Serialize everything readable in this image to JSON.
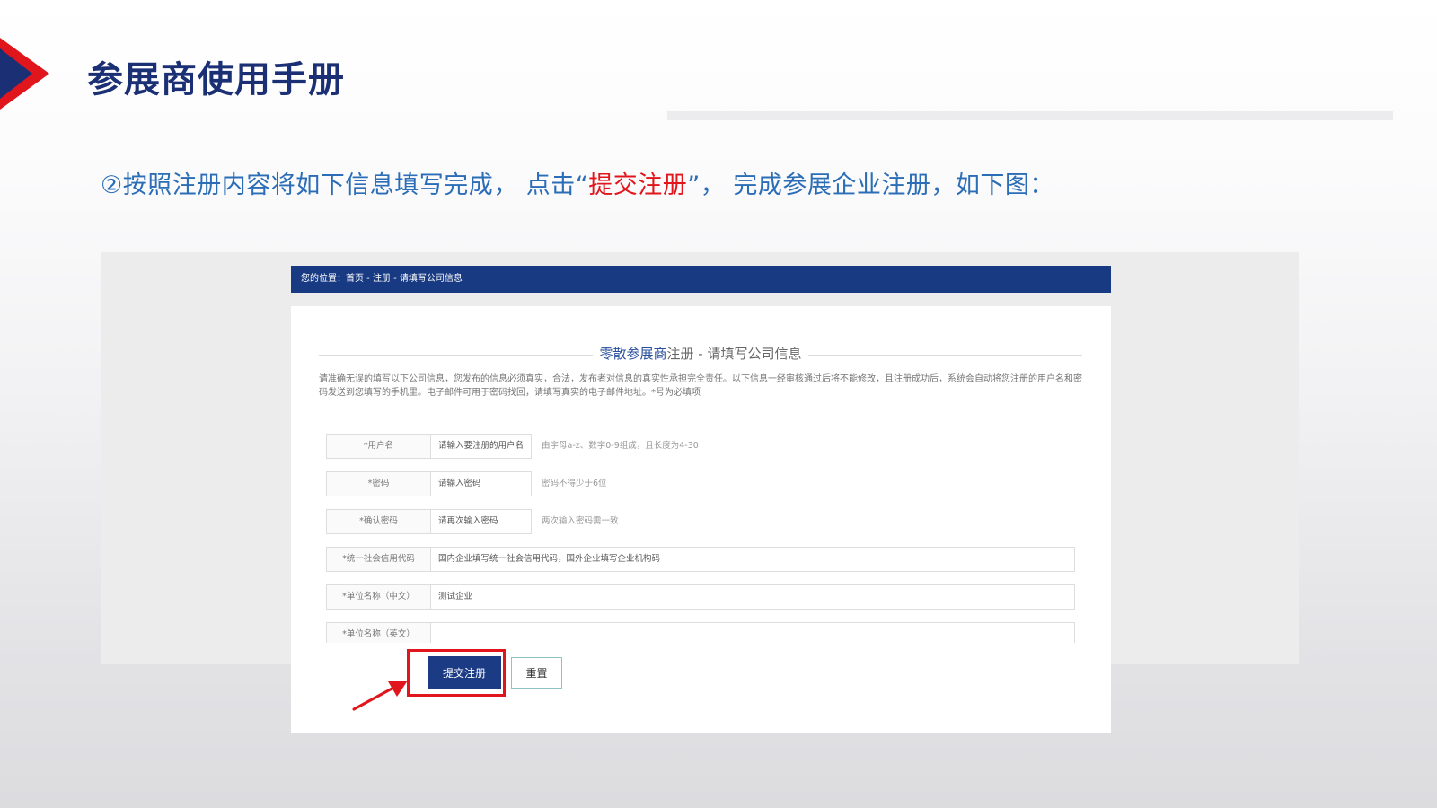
{
  "slide": {
    "title": "参展商使用手册",
    "instruction_before": "②按照注册内容将如下信息填写完成， 点击“",
    "instruction_highlight": "提交注册",
    "instruction_after": "”， 完成参展企业注册，如下图："
  },
  "colors": {
    "title": "#1b2f74",
    "instruction": "#2b6db6",
    "highlight": "#e0161c",
    "nav_bar": "#183a83",
    "submit_button": "#1c3b85"
  },
  "screenshot": {
    "breadcrumb": "您的位置：首页 - 注册 - 请填写公司信息",
    "form_title_blue": "零散参展商",
    "form_title_rest": "注册 - 请填写公司信息",
    "notice": "请准确无误的填写以下公司信息，您发布的信息必须真实，合法，发布者对信息的真实性承担完全责任。以下信息一经审核通过后将不能修改，且注册成功后，系统会自动将您注册的用户名和密码发送到您填写的手机里。电子邮件可用于密码找回，请填写真实的电子邮件地址。*号为必填项",
    "fields": [
      {
        "label": "*用户名",
        "value": "请输入要注册的用户名",
        "hint": "由字母a-z、数字0-9组成，且长度为4-30"
      },
      {
        "label": "*密码",
        "value": "请输入密码",
        "hint": "密码不得少于6位"
      },
      {
        "label": "*确认密码",
        "value": "请再次输入密码",
        "hint": "两次输入密码需一致"
      },
      {
        "label": "*统一社会信用代码",
        "value": "国内企业填写统一社会信用代码，国外企业填写企业机构码",
        "hint": ""
      },
      {
        "label": "*单位名称（中文）",
        "value": "测试企业",
        "hint": ""
      },
      {
        "label": "*单位名称（英文）",
        "value": "",
        "hint": ""
      }
    ],
    "submit_label": "提交注册",
    "reset_label": "重置"
  },
  "icons": {
    "slide_marker": "triangle-marker-icon",
    "pointer": "red-arrow-icon"
  }
}
